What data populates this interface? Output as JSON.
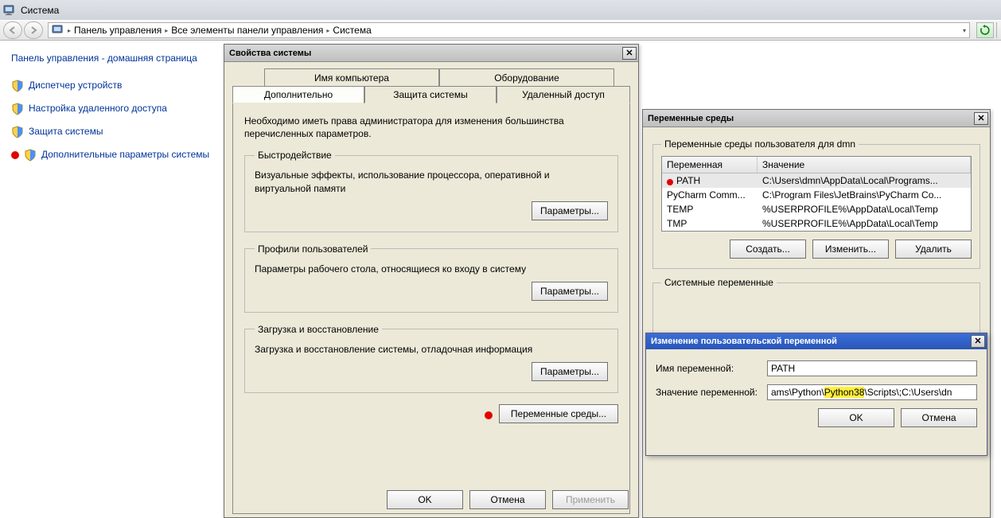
{
  "sys_window": {
    "title": "Система",
    "breadcrumbs": [
      "Панель управления",
      "Все элементы панели управления",
      "Система"
    ]
  },
  "leftpane": {
    "home": "Панель управления - домашняя страница",
    "links": [
      "Диспетчер устройств",
      "Настройка удаленного доступа",
      "Защита системы",
      "Дополнительные параметры системы"
    ]
  },
  "sysprops": {
    "title": "Свойства системы",
    "tabs_back": [
      "Имя компьютера",
      "Оборудование"
    ],
    "tabs_front": [
      "Дополнительно",
      "Защита системы",
      "Удаленный доступ"
    ],
    "note": "Необходимо иметь права администратора для изменения большинства перечисленных параметров.",
    "groups": {
      "perf": {
        "legend": "Быстродействие",
        "text": "Визуальные эффекты, использование процессора, оперативной и виртуальной памяти",
        "btn": "Параметры..."
      },
      "profiles": {
        "legend": "Профили пользователей",
        "text": "Параметры рабочего стола, относящиеся ко входу в систему",
        "btn": "Параметры..."
      },
      "startup": {
        "legend": "Загрузка и восстановление",
        "text": "Загрузка и восстановление системы, отладочная информация",
        "btn": "Параметры..."
      }
    },
    "env_btn": "Переменные среды...",
    "ok": "OK",
    "cancel": "Отмена",
    "apply": "Применить"
  },
  "envdlg": {
    "title": "Переменные среды",
    "user_group_legend": "Переменные среды пользователя для dmn",
    "sys_group_legend": "Системные переменные",
    "cols": {
      "name": "Переменная",
      "value": "Значение"
    },
    "user_vars": [
      {
        "name": "PATH",
        "value": "C:\\Users\\dmn\\AppData\\Local\\Programs..."
      },
      {
        "name": "PyCharm Comm...",
        "value": "C:\\Program Files\\JetBrains\\PyCharm Co..."
      },
      {
        "name": "TEMP",
        "value": "%USERPROFILE%\\AppData\\Local\\Temp"
      },
      {
        "name": "TMP",
        "value": "%USERPROFILE%\\AppData\\Local\\Temp"
      }
    ],
    "btns": {
      "new": "Создать...",
      "edit": "Изменить...",
      "del": "Удалить"
    },
    "ok": "OK",
    "cancel": "Отмена"
  },
  "editdlg": {
    "title": "Изменение пользовательской переменной",
    "name_label": "Имя переменной:",
    "value_label": "Значение переменной:",
    "name_value": "PATH",
    "value_pre": "ams\\Python\\",
    "value_hl": "Python38",
    "value_post": "\\Scripts\\;C:\\Users\\dn",
    "value_full": "ams\\Python\\Python38\\Scripts\\;C:\\Users\\dn",
    "ok": "OK",
    "cancel": "Отмена"
  }
}
